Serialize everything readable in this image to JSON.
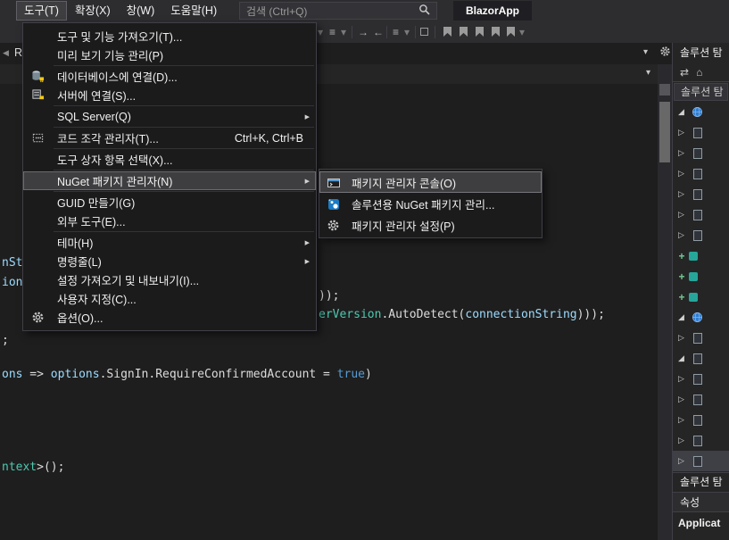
{
  "window": {
    "app_title": "BlazorApp"
  },
  "menubar": {
    "items": [
      {
        "label": "도구(T)",
        "active": true
      },
      {
        "label": "확장(X)"
      },
      {
        "label": "창(W)"
      },
      {
        "label": "도움말(H)"
      }
    ],
    "search_placeholder": "검색 (Ctrl+Q)"
  },
  "editor": {
    "tab_fragment": "R",
    "lines": [
      {
        "parts": [
          {
            "t": "nSt",
            "c": "v"
          }
        ]
      },
      {
        "parts": [
          {
            "t": "ion",
            "c": "v"
          }
        ]
      },
      {
        "parts": [
          {
            "t": "));",
            "c": "p"
          }
        ]
      },
      {
        "parts": [
          {
            "t": "erVersion",
            "c": "t"
          },
          {
            "t": ".AutoDetect(",
            "c": "p"
          },
          {
            "t": "connectionString",
            "c": "v"
          },
          {
            "t": ")));",
            "c": "p"
          }
        ]
      },
      {
        "parts": [
          {
            "t": ";",
            "c": "p"
          }
        ]
      },
      {
        "parts": [
          {
            "t": "ons",
            "c": "v"
          },
          {
            "t": " => ",
            "c": "p"
          },
          {
            "t": "options",
            "c": "v"
          },
          {
            "t": ".SignIn.RequireConfirmedAccount = ",
            "c": "p"
          },
          {
            "t": "true",
            "c": "k"
          },
          {
            "t": ")",
            "c": "p"
          }
        ]
      },
      {
        "parts": [
          {
            "t": "ntext",
            "c": "t"
          },
          {
            "t": ">();",
            "c": "p"
          }
        ]
      }
    ]
  },
  "tools_menu": {
    "items": [
      {
        "label": "도구 및 기능 가져오기(T)..."
      },
      {
        "label": "미리 보기 기능 관리(P)"
      },
      {
        "type": "separator"
      },
      {
        "label": "데이터베이스에 연결(D)...",
        "icon": "database-connect-icon"
      },
      {
        "label": "서버에 연결(S)...",
        "icon": "server-connect-icon"
      },
      {
        "type": "separator"
      },
      {
        "label": "SQL Server(Q)",
        "has_submenu": true
      },
      {
        "type": "separator"
      },
      {
        "label": "코드 조각 관리자(T)...",
        "icon": "code-snippet-icon",
        "shortcut": "Ctrl+K, Ctrl+B"
      },
      {
        "type": "separator"
      },
      {
        "label": "도구 상자 항목 선택(X)..."
      },
      {
        "type": "separator"
      },
      {
        "label": "NuGet 패키지 관리자(N)",
        "has_submenu": true,
        "highlighted": true
      },
      {
        "type": "separator"
      },
      {
        "label": "GUID 만들기(G)"
      },
      {
        "label": "외부 도구(E)..."
      },
      {
        "type": "separator"
      },
      {
        "label": "테마(H)",
        "has_submenu": true
      },
      {
        "label": "명령줄(L)",
        "has_submenu": true
      },
      {
        "label": "설정 가져오기 및 내보내기(I)..."
      },
      {
        "label": "사용자 지정(C)..."
      },
      {
        "label": "옵션(O)...",
        "icon": "gear-icon"
      }
    ]
  },
  "nuget_submenu": {
    "items": [
      {
        "label": "패키지 관리자 콘솔(O)",
        "icon": "package-manager-console-icon",
        "focused": true
      },
      {
        "label": "솔루션용 NuGet 패키지 관리...",
        "icon": "nuget-icon"
      },
      {
        "label": "패키지 관리자 설정(P)",
        "icon": "gear-icon"
      }
    ]
  },
  "solution_explorer": {
    "title": "솔루션 탐",
    "search_text": "솔루션 탐",
    "bottom_tab_label": "솔루션 탐"
  },
  "properties": {
    "title": "속성",
    "selected_object": "Applicat"
  },
  "icons": {
    "collapsed": "▷",
    "expanded": "◢",
    "submenu_arrow": "▶",
    "dropdown_arrow": "▾",
    "tab_scroll_left": "◀",
    "scroll_up": "▲",
    "home": "⌂",
    "sync": "⇄",
    "list": "≡",
    "nav_forward": "→",
    "nav_back": "←",
    "pending_add": "+"
  },
  "colors": {
    "menu_bg": "#1b1b1c",
    "chrome_bg": "#2d2d30",
    "editor_bg": "#1e1e1e",
    "highlight_bg": "#3e3e40",
    "syntax_type": "#4ec9b0",
    "syntax_keyword": "#569cd6",
    "syntax_identifier": "#9cdcfe",
    "syntax_text": "#dcdcdc",
    "nuget_blue": "#1b7ac2"
  }
}
